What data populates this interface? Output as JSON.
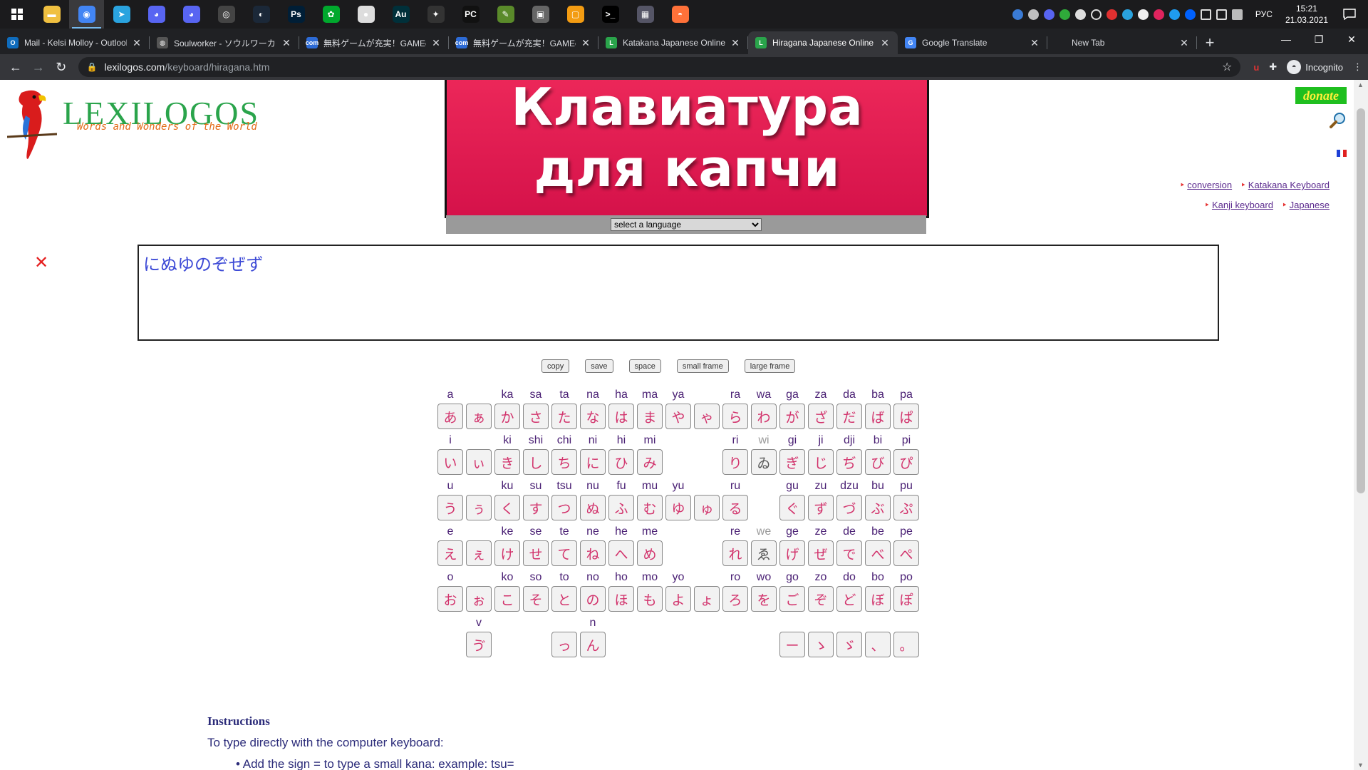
{
  "taskbar": {
    "apps": [
      {
        "name": "file-explorer-icon",
        "glyph": "▬",
        "color": "#f0c040"
      },
      {
        "name": "chrome-icon",
        "glyph": "◉",
        "color": "#4285f4",
        "active": true
      },
      {
        "name": "telegram-icon",
        "glyph": "➤",
        "color": "#2aa3df"
      },
      {
        "name": "discord-icon",
        "glyph": "◕",
        "color": "#5865f2"
      },
      {
        "name": "discord-ptb-icon",
        "glyph": "◕",
        "color": "#5865f2"
      },
      {
        "name": "obs-icon",
        "glyph": "◎",
        "color": "#444"
      },
      {
        "name": "steam-icon",
        "glyph": "◐",
        "color": "#1b2838"
      },
      {
        "name": "photoshop-icon",
        "glyph": "Ps",
        "color": "#001e36"
      },
      {
        "name": "evernote-icon",
        "glyph": "✿",
        "color": "#00a82d"
      },
      {
        "name": "whatsapp-icon",
        "glyph": "●",
        "color": "#ddd"
      },
      {
        "name": "audition-icon",
        "glyph": "Au",
        "color": "#00303a"
      },
      {
        "name": "davinci-icon",
        "glyph": "✦",
        "color": "#333"
      },
      {
        "name": "pycharm-icon",
        "glyph": "PC",
        "color": "#111"
      },
      {
        "name": "notepad-icon",
        "glyph": "✎",
        "color": "#5a8a2a"
      },
      {
        "name": "remote-icon",
        "glyph": "▣",
        "color": "#666"
      },
      {
        "name": "box-icon",
        "glyph": "▢",
        "color": "#f39c12"
      },
      {
        "name": "terminal-icon",
        "glyph": ">_",
        "color": "#000"
      },
      {
        "name": "photo-icon",
        "glyph": "▦",
        "color": "#556"
      },
      {
        "name": "firefox-icon",
        "glyph": "◓",
        "color": "#ff7139"
      }
    ],
    "language": "РУС",
    "time": "15:21",
    "date": "21.03.2021"
  },
  "tabs": [
    {
      "title": "Mail - Kelsi Molloy - Outlook",
      "fav": "O",
      "color": "#0f6cbd"
    },
    {
      "title": "Soulworker - ソウルワーカー",
      "fav": "◍",
      "color": "#555"
    },
    {
      "title": "無料ゲームが充実！GAMEcom",
      "fav": "com",
      "color": "#2d6bd6"
    },
    {
      "title": "無料ゲームが充実！GAMEcom",
      "fav": "com",
      "color": "#2d6bd6"
    },
    {
      "title": "Katakana Japanese Online K",
      "fav": "L",
      "color": "#2aa44b"
    },
    {
      "title": "Hiragana Japanese Online K",
      "fav": "L",
      "color": "#2aa44b",
      "active": true
    },
    {
      "title": "Google Translate",
      "fav": "G",
      "color": "#4285f4"
    },
    {
      "title": "New Tab",
      "fav": "",
      "color": "transparent"
    }
  ],
  "address": {
    "host": "lexilogos.com",
    "path": "/keyboard/hiragana.htm",
    "profile": "Incognito"
  },
  "page": {
    "logo_word": "LEXILOGOS",
    "logo_sub": "Words and Wonders of the World",
    "banner_line1": "Клавиатура",
    "banner_line2": "для капчи",
    "language_select": "select a language",
    "donate": "donate",
    "links_row1": [
      "conversion",
      "Katakana Keyboard"
    ],
    "links_row2": [
      "Kanji keyboard",
      "Japanese"
    ],
    "editor_text": "にぬゆのぞぜず",
    "actions": [
      "copy",
      "save",
      "space",
      "small frame",
      "large frame"
    ],
    "instructions_title": "Instructions",
    "instructions_text": "To type directly with the computer keyboard:",
    "instructions_bullet": "Add the sign = to type a small kana: example: tsu="
  },
  "keyboard": [
    [
      [
        "a",
        "あ"
      ],
      [
        "",
        "ぁ"
      ],
      [
        "ka",
        "か"
      ],
      [
        "sa",
        "さ"
      ],
      [
        "ta",
        "た"
      ],
      [
        "na",
        "な"
      ],
      [
        "ha",
        "は"
      ],
      [
        "ma",
        "ま"
      ],
      [
        "ya",
        "や"
      ],
      [
        "",
        "ゃ"
      ],
      [
        "ra",
        "ら"
      ],
      [
        "wa",
        "わ"
      ],
      [
        "ga",
        "が"
      ],
      [
        "za",
        "ざ"
      ],
      [
        "da",
        "だ"
      ],
      [
        "ba",
        "ば"
      ],
      [
        "pa",
        "ぱ"
      ]
    ],
    [
      [
        "i",
        "い"
      ],
      [
        "",
        "ぃ"
      ],
      [
        "ki",
        "き"
      ],
      [
        "shi",
        "し"
      ],
      [
        "chi",
        "ち"
      ],
      [
        "ni",
        "に"
      ],
      [
        "hi",
        "ひ"
      ],
      [
        "mi",
        "み"
      ],
      null,
      null,
      [
        "ri",
        "り"
      ],
      [
        "wi",
        "ゐ",
        "gray"
      ],
      [
        "gi",
        "ぎ"
      ],
      [
        "ji",
        "じ"
      ],
      [
        "dji",
        "ぢ"
      ],
      [
        "bi",
        "び"
      ],
      [
        "pi",
        "ぴ"
      ]
    ],
    [
      [
        "u",
        "う"
      ],
      [
        "",
        "ぅ"
      ],
      [
        "ku",
        "く"
      ],
      [
        "su",
        "す"
      ],
      [
        "tsu",
        "つ"
      ],
      [
        "nu",
        "ぬ"
      ],
      [
        "fu",
        "ふ"
      ],
      [
        "mu",
        "む"
      ],
      [
        "yu",
        "ゆ"
      ],
      [
        "",
        "ゅ"
      ],
      [
        "ru",
        "る"
      ],
      null,
      [
        "gu",
        "ぐ"
      ],
      [
        "zu",
        "ず"
      ],
      [
        "dzu",
        "づ"
      ],
      [
        "bu",
        "ぶ"
      ],
      [
        "pu",
        "ぷ"
      ]
    ],
    [
      [
        "e",
        "え"
      ],
      [
        "",
        "ぇ"
      ],
      [
        "ke",
        "け"
      ],
      [
        "se",
        "せ"
      ],
      [
        "te",
        "て"
      ],
      [
        "ne",
        "ね"
      ],
      [
        "he",
        "へ"
      ],
      [
        "me",
        "め"
      ],
      null,
      null,
      [
        "re",
        "れ"
      ],
      [
        "we",
        "ゑ",
        "gray"
      ],
      [
        "ge",
        "げ"
      ],
      [
        "ze",
        "ぜ"
      ],
      [
        "de",
        "で"
      ],
      [
        "be",
        "べ"
      ],
      [
        "pe",
        "ぺ"
      ]
    ],
    [
      [
        "o",
        "お"
      ],
      [
        "",
        "ぉ"
      ],
      [
        "ko",
        "こ"
      ],
      [
        "so",
        "そ"
      ],
      [
        "to",
        "と"
      ],
      [
        "no",
        "の"
      ],
      [
        "ho",
        "ほ"
      ],
      [
        "mo",
        "も"
      ],
      [
        "yo",
        "よ"
      ],
      [
        "",
        "ょ"
      ],
      [
        "ro",
        "ろ"
      ],
      [
        "wo",
        "を"
      ],
      [
        "go",
        "ご"
      ],
      [
        "zo",
        "ぞ"
      ],
      [
        "do",
        "ど"
      ],
      [
        "bo",
        "ぼ"
      ],
      [
        "po",
        "ぽ"
      ]
    ],
    [
      null,
      [
        "v",
        "ゔ"
      ],
      null,
      null,
      [
        "",
        "っ"
      ],
      [
        "n",
        "ん"
      ],
      null,
      null,
      null,
      null,
      null,
      null,
      [
        "",
        "ー"
      ],
      [
        "",
        "ゝ"
      ],
      [
        "",
        "ゞ"
      ],
      [
        "",
        "、"
      ],
      [
        "",
        "。"
      ]
    ]
  ]
}
